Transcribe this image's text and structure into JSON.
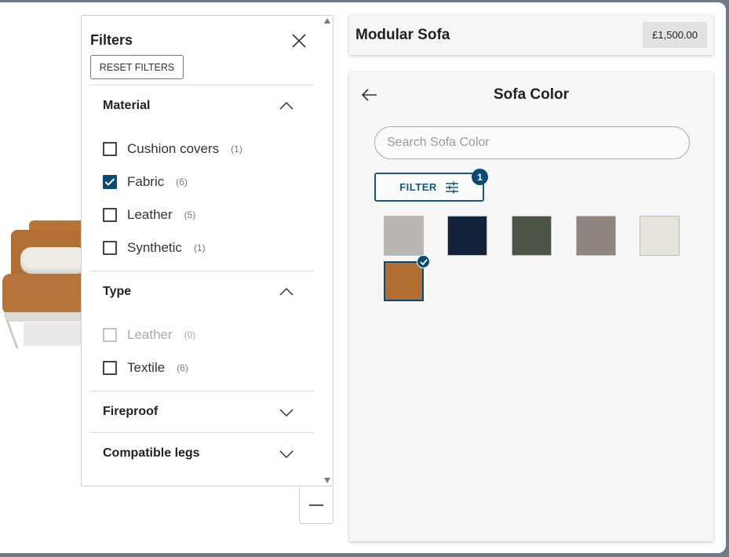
{
  "filters": {
    "title": "Filters",
    "reset_label": "RESET FILTERS",
    "sections": {
      "material": {
        "title": "Material",
        "options": [
          {
            "label": "Cushion covers",
            "count": "(1)",
            "checked": false
          },
          {
            "label": "Fabric",
            "count": "(6)",
            "checked": true
          },
          {
            "label": "Leather",
            "count": "(5)",
            "checked": false
          },
          {
            "label": "Synthetic",
            "count": "(1)",
            "checked": false
          }
        ]
      },
      "type": {
        "title": "Type",
        "options": [
          {
            "label": "Leather",
            "count": "(0)",
            "checked": false,
            "disabled": true
          },
          {
            "label": "Textile",
            "count": "(6)",
            "checked": false
          }
        ]
      },
      "fireproof": {
        "title": "Fireproof"
      },
      "legs": {
        "title": "Compatible legs"
      }
    }
  },
  "product": {
    "name": "Modular Sofa",
    "price": "£1,500.00"
  },
  "color_panel": {
    "title": "Sofa Color",
    "search_placeholder": "Search Sofa Color",
    "filter_label": "FILTER",
    "filter_badge": "1",
    "swatches": [
      {
        "color": "#b9b7b4",
        "selected": false
      },
      {
        "color": "#14213a",
        "selected": false
      },
      {
        "color": "#4d5347",
        "selected": false
      },
      {
        "color": "#8e8580",
        "selected": false
      },
      {
        "color": "#e6e5dd",
        "selected": false
      },
      {
        "color": "#b26e32",
        "selected": true
      }
    ]
  },
  "colors": {
    "accent": "#0b4a72"
  }
}
